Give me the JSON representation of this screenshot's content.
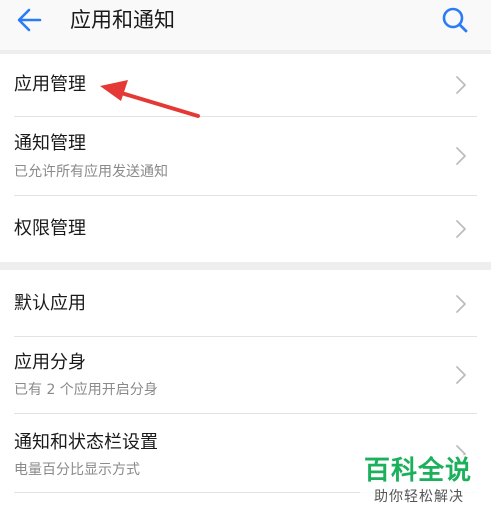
{
  "header": {
    "back_icon": "back-arrow-icon",
    "title": "应用和通知",
    "search_icon": "search-icon",
    "accent_color": "#2a7bf6"
  },
  "group1": [
    {
      "label": "应用管理",
      "sub": ""
    },
    {
      "label": "通知管理",
      "sub": "已允许所有应用发送通知"
    },
    {
      "label": "权限管理",
      "sub": ""
    }
  ],
  "group2": [
    {
      "label": "默认应用",
      "sub": ""
    },
    {
      "label": "应用分身",
      "sub": "已有 2 个应用开启分身"
    },
    {
      "label": "通知和状态栏设置",
      "sub": "电量百分比显示方式"
    }
  ],
  "annotation": {
    "color": "#e53935",
    "icon": "red-arrow-annotation"
  },
  "watermark": {
    "title": "百科全说",
    "subtitle": "助你轻松解决",
    "color": "#1bb05c"
  }
}
